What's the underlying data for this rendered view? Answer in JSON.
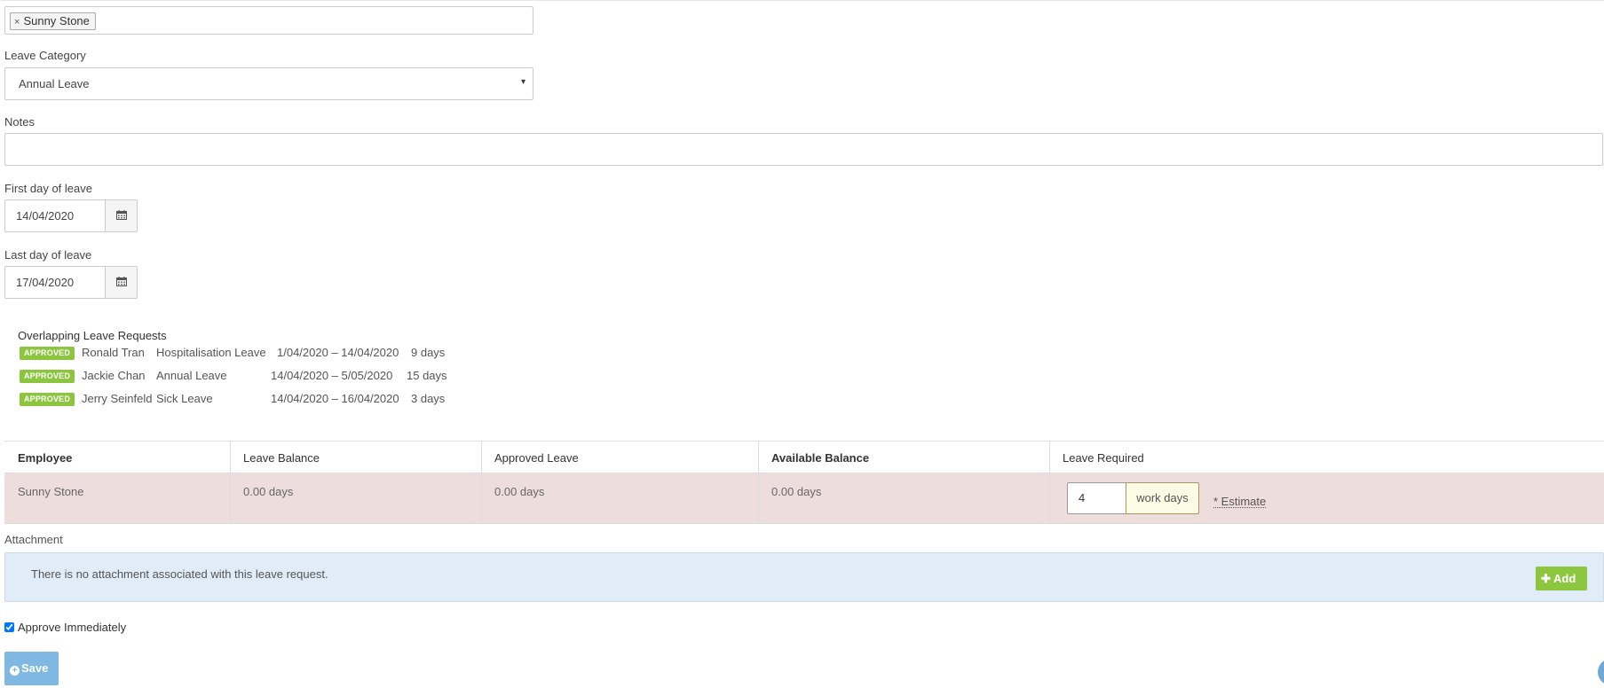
{
  "employees_field": {
    "selected_tag": "Sunny Stone",
    "remove_glyph": "×"
  },
  "leave_category": {
    "label": "Leave Category",
    "value": "Annual Leave",
    "caret": "▾"
  },
  "notes": {
    "label": "Notes",
    "value": ""
  },
  "first_day": {
    "label": "First day of leave",
    "value": "14/04/2020",
    "icon": "calendar-icon"
  },
  "last_day": {
    "label": "Last day of leave",
    "value": "17/04/2020",
    "icon": "calendar-icon"
  },
  "overlapping": {
    "title": "Overlapping Leave Requests",
    "rows": [
      {
        "status": "APPROVED",
        "name": "Ronald Tran",
        "type": "Hospitalisation Leave",
        "range": "1/04/2020 – 14/04/2020",
        "days": "9 days"
      },
      {
        "status": "APPROVED",
        "name": "Jackie Chan",
        "type": "Annual Leave",
        "range": "14/04/2020 – 5/05/2020",
        "days": "15 days"
      },
      {
        "status": "APPROVED",
        "name": "Jerry Seinfeld",
        "type": "Sick Leave",
        "range": "14/04/2020 – 16/04/2020",
        "days": "3 days"
      }
    ],
    "status_color": "#8cc63f"
  },
  "balance_table": {
    "headers": [
      "Employee",
      "Leave Balance",
      "Approved Leave",
      "Available Balance",
      "Leave Required"
    ],
    "row": {
      "employee": "Sunny Stone",
      "leave_balance": "0.00 days",
      "approved_leave": "0.00 days",
      "available_balance": "0.00 days",
      "required_value": "4",
      "required_unit": "work days",
      "estimate_link": "* Estimate"
    },
    "row_color": "#eedddd"
  },
  "attachment": {
    "label": "Attachment",
    "message": "There is no attachment associated with this leave request.",
    "add_label": "Add",
    "add_icon": "plus-icon"
  },
  "approve": {
    "label": "Approve Immediately",
    "checked": true
  },
  "save": {
    "label": "Save",
    "icon": "plus-circle-icon",
    "color": "#7fb8e3"
  }
}
